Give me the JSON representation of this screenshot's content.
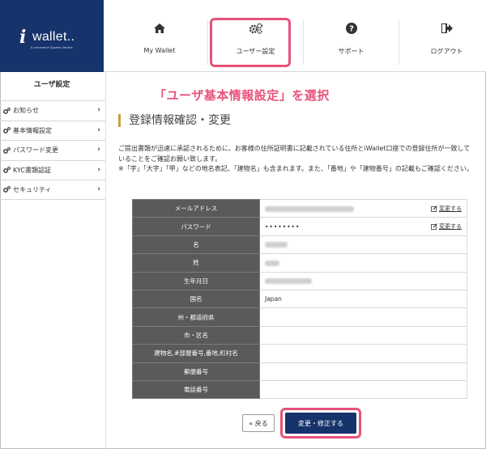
{
  "brand": {
    "logo_text": "wallet..",
    "logo_sub": "E-commerce System Service"
  },
  "nav": {
    "items": [
      {
        "label": "My Wallet",
        "icon": "home-icon"
      },
      {
        "label": "ユーザー設定",
        "icon": "gears-icon"
      },
      {
        "label": "サポート",
        "icon": "question-icon"
      },
      {
        "label": "ログアウト",
        "icon": "logout-icon"
      }
    ]
  },
  "sidebar": {
    "title": "ユーザ設定",
    "items": [
      {
        "label": "お知らせ"
      },
      {
        "label": "基本情報設定"
      },
      {
        "label": "パスワード変更"
      },
      {
        "label": "KYC書類認証"
      },
      {
        "label": "セキュリティ"
      }
    ]
  },
  "annotation": "「ユーザ基本情報設定」を選択",
  "main": {
    "title": "登録情報確認・変更",
    "desc_1": "ご提出書類が迅速に承認されるために、お客様の住所証明書に記載されている住所とiWallet口座での登録住所が一致していることをご確認お願い致します。",
    "desc_2": "※「字」「大字」「甲」などの地名表記、「建物名」も含まれます。また、「番地」や「建物番号」の記載もご確認ください。",
    "change_label": "変更する",
    "password_mask": "••••••••",
    "country_value": "Japan",
    "rows": [
      {
        "label": "メールアドレス"
      },
      {
        "label": "パスワード"
      },
      {
        "label": "名"
      },
      {
        "label": "姓"
      },
      {
        "label": "生年月日"
      },
      {
        "label": "国名"
      },
      {
        "label": "州・都道府県"
      },
      {
        "label": "市・区名"
      },
      {
        "label": "建物名,#部屋番号,番地,町村名"
      },
      {
        "label": "郵便番号"
      },
      {
        "label": "電話番号"
      }
    ],
    "back_label": "« 戻る",
    "edit_label": "変更・修正する"
  },
  "colors": {
    "brand_navy": "#16336b",
    "highlight_pink": "#e8517a",
    "table_header": "#5a5a5a",
    "title_accent": "#c7a23a"
  }
}
